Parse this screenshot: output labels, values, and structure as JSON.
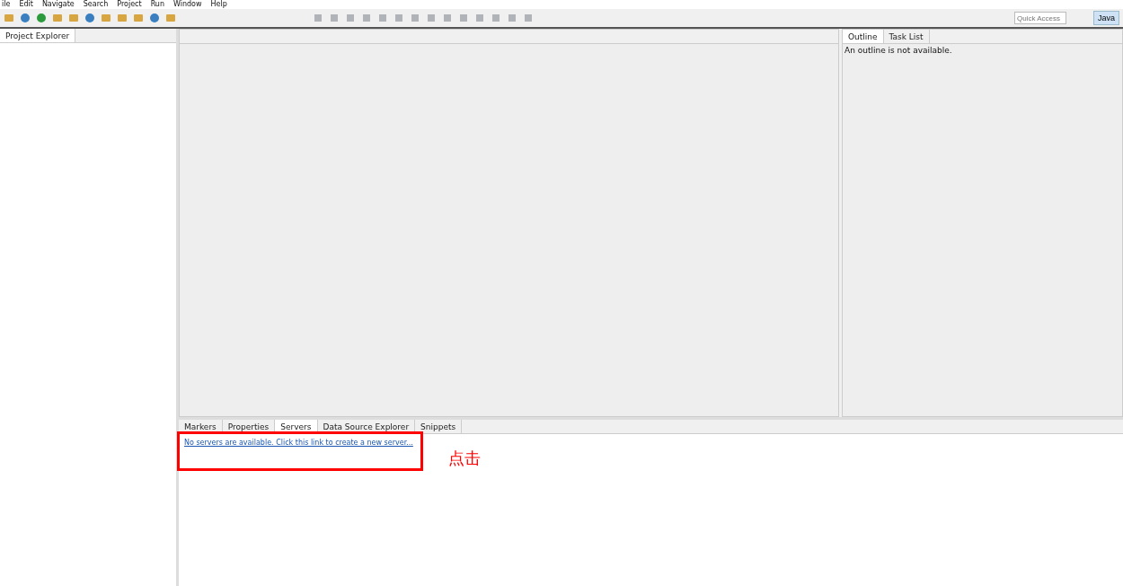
{
  "menu": [
    "ile",
    "Edit",
    "Navigate",
    "Search",
    "Project",
    "Run",
    "Window",
    "Help"
  ],
  "quick_access": {
    "placeholder": "Quick Access"
  },
  "perspective": {
    "label": "Java",
    "selected": true
  },
  "left_panel": {
    "tabs": [
      {
        "label": "Project Explorer",
        "selected": true
      }
    ]
  },
  "right_panel": {
    "tabs": [
      {
        "label": "Outline",
        "selected": true
      },
      {
        "label": "Task List",
        "selected": false
      }
    ],
    "message": "An outline is not available."
  },
  "bottom_panel": {
    "tabs": [
      {
        "label": "Markers",
        "selected": false
      },
      {
        "label": "Properties",
        "selected": false
      },
      {
        "label": "Servers",
        "selected": true
      },
      {
        "label": "Data Source Explorer",
        "selected": false
      },
      {
        "label": "Snippets",
        "selected": false
      }
    ],
    "link": "No servers are available. Click this link to create a new server..."
  },
  "annotation": {
    "text": "点击"
  }
}
